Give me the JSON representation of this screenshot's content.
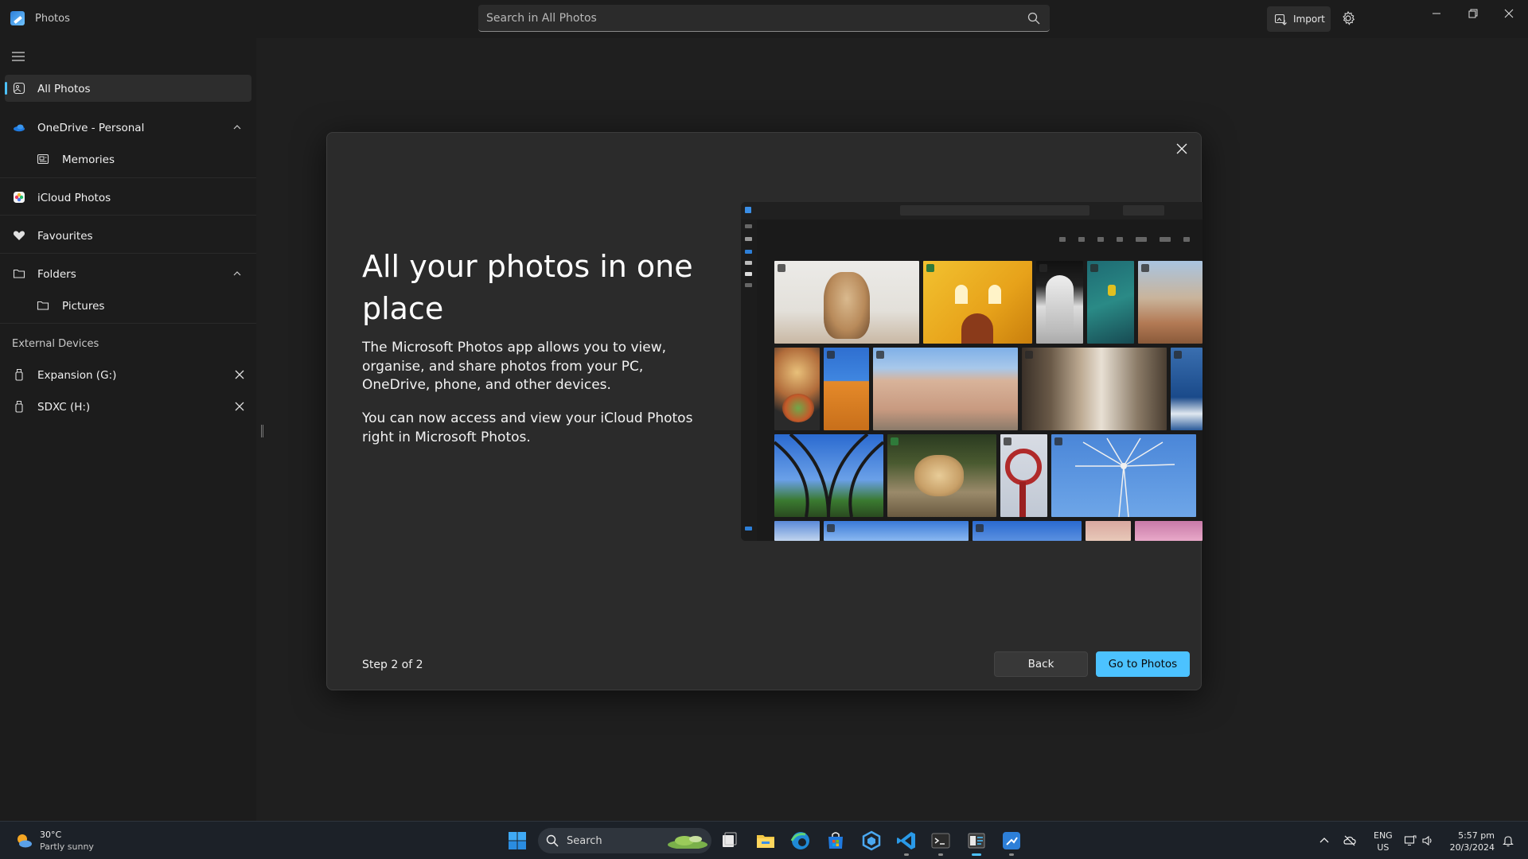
{
  "titlebar": {
    "app_name": "Photos",
    "search_placeholder": "Search in All Photos",
    "import_label": "Import"
  },
  "sidebar": {
    "all_photos": "All Photos",
    "onedrive": "OneDrive - Personal",
    "memories": "Memories",
    "icloud": "iCloud Photos",
    "favourites": "Favourites",
    "folders": "Folders",
    "pictures": "Pictures",
    "external_header": "External Devices",
    "devices": [
      "Expansion (G:)",
      "SDXC (H:)"
    ]
  },
  "dialog": {
    "title": "All your photos in one place",
    "paragraph1": "The Microsoft Photos app allows you to view, organise, and share photos from your PC, OneDrive, phone, and other devices.",
    "paragraph2": "You can now access and view your iCloud Photos right in Microsoft Photos.",
    "step": "Step 2 of 2",
    "back_label": "Back",
    "go_label": "Go to Photos"
  },
  "taskbar": {
    "temperature": "30°C",
    "weather": "Partly sunny",
    "search_label": "Search",
    "lang1": "ENG",
    "lang2": "US",
    "time": "5:57 pm",
    "date": "20/3/2024"
  },
  "colors": {
    "accent": "#4cc2ff",
    "background": "#1f1f1f",
    "dialog": "#2b2b2b"
  }
}
